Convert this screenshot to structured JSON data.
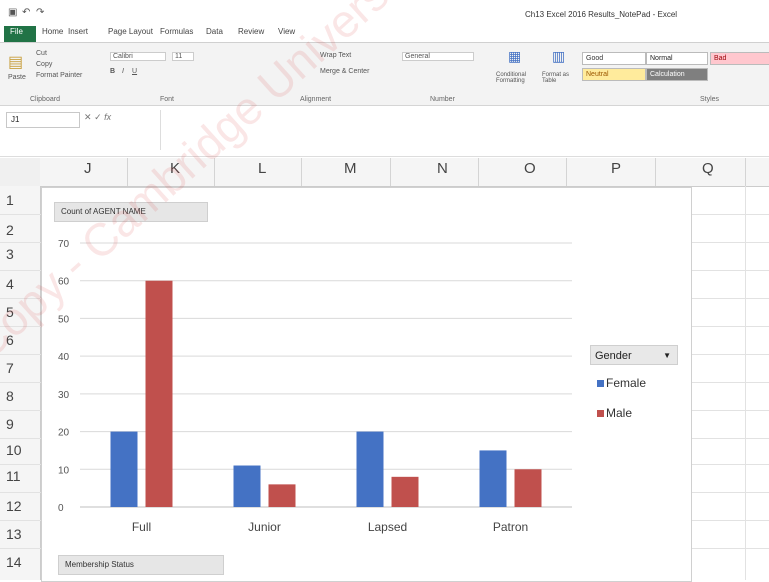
{
  "window": {
    "title": "Ch13 Excel 2016 Results_NotePad - Excel"
  },
  "ribbon": {
    "tabs": [
      "File",
      "Home",
      "Insert",
      "Page Layout",
      "Formulas",
      "Data",
      "Review",
      "View"
    ],
    "clipboard": {
      "paste": "Paste",
      "cut": "Cut",
      "copy": "Copy",
      "format_painter": "Format Painter"
    },
    "font_name": "Calibri",
    "font_size": "11",
    "wrap_text": "Wrap Text",
    "merge_center": "Merge & Center",
    "number_format": "General",
    "conditional_formatting": "Conditional Formatting",
    "format_as_table": "Format as Table",
    "styles": [
      "Normal",
      "Bad",
      "Good",
      "Neutral",
      "Calculation"
    ],
    "groups": [
      "Clipboard",
      "Font",
      "Alignment",
      "Number",
      "Styles"
    ]
  },
  "formula_bar": {
    "name_box": "J1",
    "fx": "fx",
    "value": ""
  },
  "columns": [
    "J",
    "K",
    "L",
    "M",
    "N",
    "O",
    "P",
    "Q"
  ],
  "rows": [
    "1",
    "2",
    "3",
    "4",
    "5",
    "6",
    "7",
    "8",
    "9",
    "10",
    "11",
    "12",
    "13",
    "14"
  ],
  "pivot_buttons": {
    "values": "Count of AGENT NAME",
    "axis": "Membership Status"
  },
  "chart_data": {
    "type": "bar",
    "categories": [
      "Full",
      "Junior",
      "Lapsed",
      "Patron"
    ],
    "series": [
      {
        "name": "Female",
        "values": [
          20,
          11,
          20,
          15
        ],
        "color": "#4472c4"
      },
      {
        "name": "Male",
        "values": [
          60,
          6,
          8,
          10
        ],
        "color": "#c0504d"
      }
    ],
    "ylim": [
      0,
      70
    ],
    "yticks": [
      "0",
      "10",
      "20",
      "30",
      "40",
      "50",
      "60",
      "70"
    ],
    "legend_title": "Gender",
    "legend_position": "right",
    "grid": true
  },
  "watermark": {
    "text": "Copy - Cambridge University Press - Review"
  }
}
